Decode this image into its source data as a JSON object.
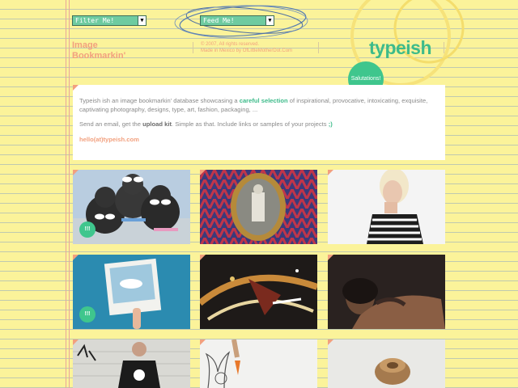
{
  "header": {
    "filter_select": "Filter Me!",
    "feed_select": "Feed Me!",
    "tagline": "Image Bookmarkin'",
    "copyright_line1": "© 2007, All rights reserved.",
    "copyright_line2": "Made in Mexico by OfLittleMotherDot.Com",
    "logo": "typeish",
    "greeting": "Salutations!"
  },
  "intro": {
    "p1_a": "Typeish ish an image bookmarkin' database showcasing a ",
    "p1_link": "careful selection",
    "p1_b": " of inspirational, provocative, intoxicating, exquisite, captivating photography, designs, type, art, fashion, packaging, ...",
    "p2_a": "Send an email, get the ",
    "p2_bold": "upload kit",
    "p2_b": ". Simple as that. Include links or samples of your projects ",
    "p2_smiley": ";)",
    "email": "hello(at)typeish.com"
  },
  "gallery": {
    "badge": "!!!",
    "items": [
      {
        "name": "poodles-sunglasses"
      },
      {
        "name": "framed-vintage-photo"
      },
      {
        "name": "woman-striped-top"
      },
      {
        "name": "polaroid-sky"
      },
      {
        "name": "abstract-sneaker-art"
      },
      {
        "name": "tattooed-woman"
      },
      {
        "name": "graffiti-man"
      },
      {
        "name": "bunny-carrot-drawing"
      },
      {
        "name": "wooden-object"
      }
    ]
  },
  "colors": {
    "paper": "#fbf39a",
    "accent_green": "#3fc68d",
    "accent_orange": "#f2a07e"
  }
}
